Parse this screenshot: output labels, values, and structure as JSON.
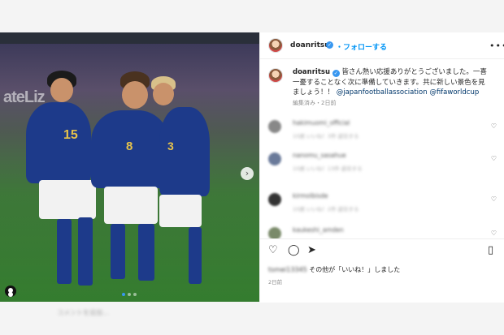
{
  "post": {
    "username": "doanritsu",
    "follow_label": "・フォローする",
    "more_label": "•••",
    "verified_glyph": "✓",
    "caption_text": "皆さん熱い応援ありがとうございました。一喜一憂することなく次に準備していきます。共に新しい景色を見ましょう！！",
    "mentions": "@japanfootballassociation @fifaworldcup",
    "edited_label": "編集済み・2日前"
  },
  "media": {
    "stand_text": "ateLiz",
    "numbers": [
      "15",
      "8",
      "3"
    ],
    "next_arrow": "›",
    "carousel_count": 3,
    "carousel_active": 1
  },
  "comments": [
    {
      "name": "hakimuomi_official",
      "meta": "10週  いいね！3件  返信する"
    },
    {
      "name": "nanomu_sasahue",
      "meta": "10週  いいね！13件  返信する"
    },
    {
      "name": "kirmolbisde",
      "meta": "10週  いいね！2件  返信する"
    },
    {
      "name": "kaukeshi_amden",
      "meta": "10週  いいね！1件  返信する"
    }
  ],
  "actions": {
    "like_icon": "heart-icon",
    "comment_icon": "comment-icon",
    "share_icon": "share-icon",
    "save_icon": "bookmark-icon",
    "likes_user": "tsmei13345",
    "likes_suffix": "その他が「いいね！」しました",
    "date": "2日前"
  },
  "bottom_text": "コメントを追加...",
  "colors": {
    "accent": "#0095f6",
    "verified": "#3897f0",
    "mention": "#00376b"
  }
}
